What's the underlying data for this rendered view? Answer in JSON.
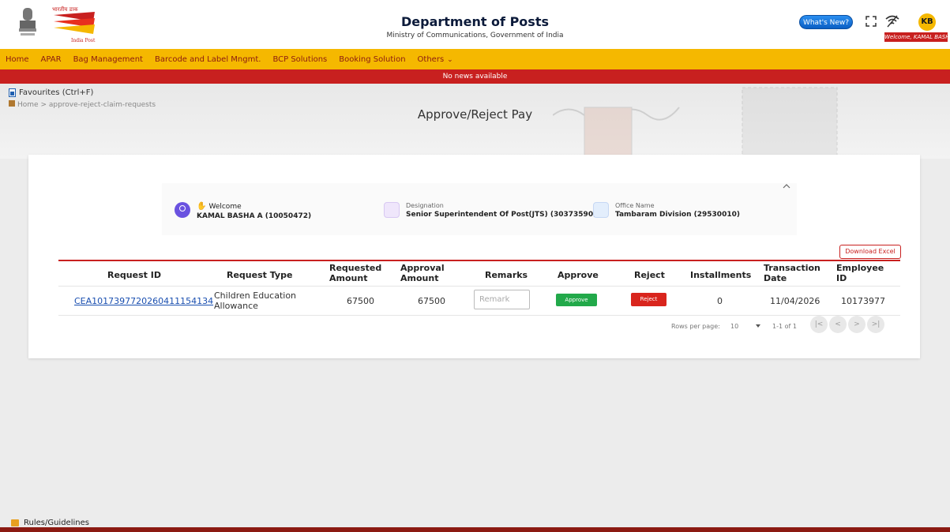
{
  "header": {
    "title": "Department of Posts",
    "subtitle": "Ministry of Communications, Government of India",
    "whats_new": "What's New?",
    "avatar_initials": "KB",
    "welcome_user": "Welcome, KAMAL BASHA"
  },
  "nav": {
    "items": [
      {
        "label": "Home"
      },
      {
        "label": "APAR"
      },
      {
        "label": "Bag Management"
      },
      {
        "label": "Barcode and Label Mngmt."
      },
      {
        "label": "BCP Solutions"
      },
      {
        "label": "Booking Solution"
      },
      {
        "label": "Others"
      }
    ]
  },
  "news": {
    "text": "No news available"
  },
  "banner": {
    "favourites": "Favourites (Ctrl+F)",
    "breadcrumb": "Home  > approve-reject-claim-requests",
    "page_title": "Approve/Reject Pay"
  },
  "profile": {
    "welcome_label": "Welcome",
    "name": "KAMAL BASHA A (10050472)",
    "designation_label": "Designation",
    "designation": "Senior Superintendent Of Post(JTS) (30373590)",
    "office_label": "Office Name",
    "office": "Tambaram Division (29530010)"
  },
  "download_excel": "Download Excel",
  "table": {
    "headers": {
      "request_id": "Request ID",
      "request_type": "Request Type",
      "requested_amount": "Requested Amount",
      "approval_amount": "Approval Amount",
      "remarks": "Remarks",
      "approve": "Approve",
      "reject": "Reject",
      "installments": "Installments",
      "transaction_date": "Transaction Date",
      "employee_id": "Employee ID"
    },
    "rows": [
      {
        "request_id": "CEA1017397720260411154134",
        "request_type": "Children Education Allowance",
        "requested_amount": "67500",
        "approval_amount": "67500",
        "remark_placeholder": "Remark",
        "approve_label": "Approve",
        "reject_label": "Reject",
        "installments": "0",
        "transaction_date": "11/04/2026",
        "employee_id": "10173977"
      }
    ]
  },
  "pagination": {
    "rows_per_page_label": "Rows per page:",
    "rows_per_page_value": "10",
    "range": "1-1 of 1",
    "first": "|<",
    "prev": "<",
    "next": ">",
    "last": ">|"
  },
  "footer": {
    "rules": "Rules/Guidelines"
  }
}
